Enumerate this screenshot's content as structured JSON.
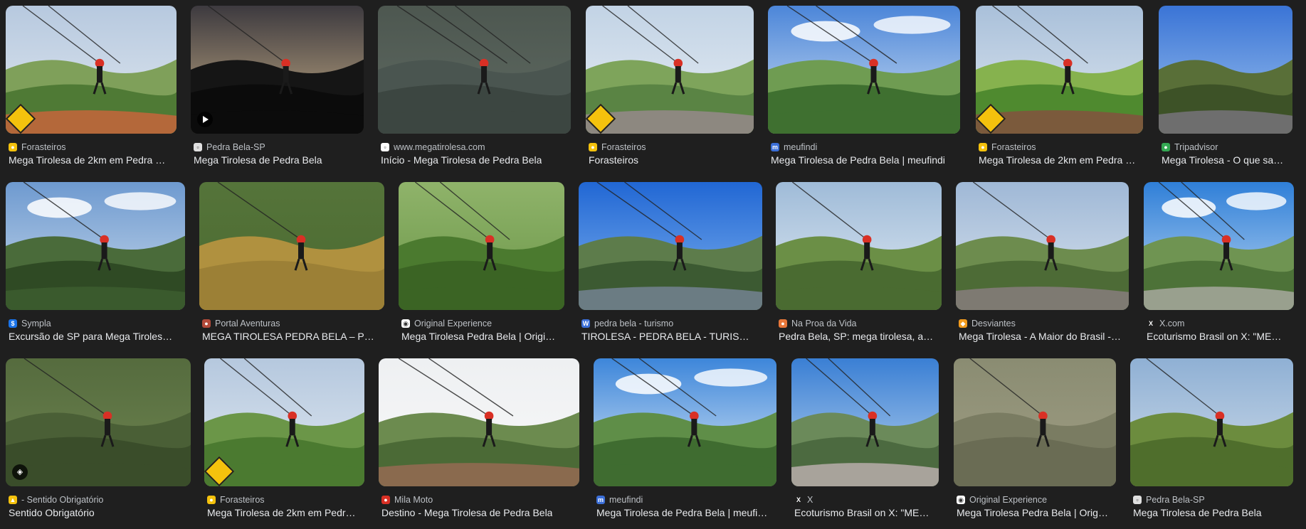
{
  "results": [
    {
      "source": "Forasteiros",
      "title": "Mega Tirolesa de 2km em Pedra …",
      "fav_color": "#f4c20d",
      "fav": "●",
      "badge": "sign",
      "scene": "platform"
    },
    {
      "source": "Pedra Bela-SP",
      "title": "Mega Tirolesa de Pedra Bela",
      "fav_color": "#e0e0e0",
      "fav": "▫",
      "badge": "play",
      "scene": "sunset"
    },
    {
      "source": "www.megatirolesa.com",
      "title": "Início - Mega Tirolesa de Pedra Bela",
      "fav_color": "#ffffff",
      "fav": "▫",
      "badge": "",
      "scene": "forest-duo"
    },
    {
      "source": "Forasteiros",
      "title": "Forasteiros",
      "fav_color": "#f4c20d",
      "fav": "●",
      "badge": "sign",
      "scene": "rock"
    },
    {
      "source": "meufindi",
      "title": "Mega Tirolesa de Pedra Bela | meufindi",
      "fav_color": "#3b6fd8",
      "fav": "m",
      "badge": "",
      "scene": "sky-duo"
    },
    {
      "source": "Forasteiros",
      "title": "Mega Tirolesa de 2km em Pedra …",
      "fav_color": "#f4c20d",
      "fav": "●",
      "badge": "sign",
      "scene": "ramp"
    },
    {
      "source": "Tripadvisor",
      "title": "Mega Tirolesa - O que sa…",
      "fav_color": "#34a853",
      "fav": "●",
      "badge": "",
      "scene": "hill"
    },
    {
      "source": "Sympla",
      "title": "Excursão de SP para Mega Tiroles…",
      "fav_color": "#1a73e8",
      "fav": "$",
      "badge": "",
      "scene": "valley-rider"
    },
    {
      "source": "Portal Aventuras",
      "title": "MEGA TIROLESA PEDRA BELA – P…",
      "fav_color": "#b34a3a",
      "fav": "●",
      "badge": "",
      "scene": "field-flip"
    },
    {
      "source": "Original Experience",
      "title": "Mega Tirolesa Pedra Bela | Origi…",
      "fav_color": "#ffffff",
      "fav": "◉",
      "badge": "",
      "scene": "green-duo"
    },
    {
      "source": "pedra bela - turismo",
      "title": "TIROLESA - PEDRA BELA - TURIS…",
      "fav_color": "#3b6fd8",
      "fav": "W",
      "badge": "",
      "scene": "blue-sky"
    },
    {
      "source": "Na Proa da Vida",
      "title": "Pedra Bela, SP: mega tirolesa, a…",
      "fav_color": "#e8773a",
      "fav": "●",
      "badge": "",
      "scene": "selfie"
    },
    {
      "source": "Desviantes",
      "title": "Mega Tirolesa - A Maior do Brasil -…",
      "fav_color": "#f29b1d",
      "fav": "◆",
      "badge": "",
      "scene": "pulley"
    },
    {
      "source": "X.com",
      "title": "Ecoturismo Brasil on X: \"ME…",
      "fav_color": "#1f1f1f",
      "fav": "X",
      "badge": "",
      "scene": "town-rider"
    },
    {
      "source": "- Sentido Obrigatório",
      "title": "Sentido Obrigatório",
      "fav_color": "#f4c20d",
      "fav": "▲",
      "badge": "tag",
      "scene": "forest-solo"
    },
    {
      "source": "Forasteiros",
      "title": "Mega Tirolesa de 2km em Pedr…",
      "fav_color": "#f4c20d",
      "fav": "●",
      "badge": "sign",
      "scene": "helmet-back"
    },
    {
      "source": "Mila Moto",
      "title": "Destino - Mega Tirolesa de Pedra Bela",
      "fav_color": "#d93025",
      "fav": "●",
      "badge": "",
      "scene": "deck"
    },
    {
      "source": "meufindi",
      "title": "Mega Tirolesa de Pedra Bela | meufi…",
      "fav_color": "#3b6fd8",
      "fav": "m",
      "badge": "",
      "scene": "cloud-rider"
    },
    {
      "source": "X",
      "title": "Ecoturismo Brasil on X: \"ME…",
      "fav_color": "#1f1f1f",
      "fav": "X",
      "badge": "",
      "scene": "upside"
    },
    {
      "source": "Original Experience",
      "title": "Mega Tirolesa Pedra Bela | Orig…",
      "fav_color": "#ffffff",
      "fav": "◉",
      "badge": "",
      "scene": "blur-rider"
    },
    {
      "source": "Pedra Bela-SP",
      "title": "Mega Tirolesa de Pedra Bela",
      "fav_color": "#e0e0e0",
      "fav": "▫",
      "badge": "",
      "scene": "cable-hill"
    }
  ]
}
